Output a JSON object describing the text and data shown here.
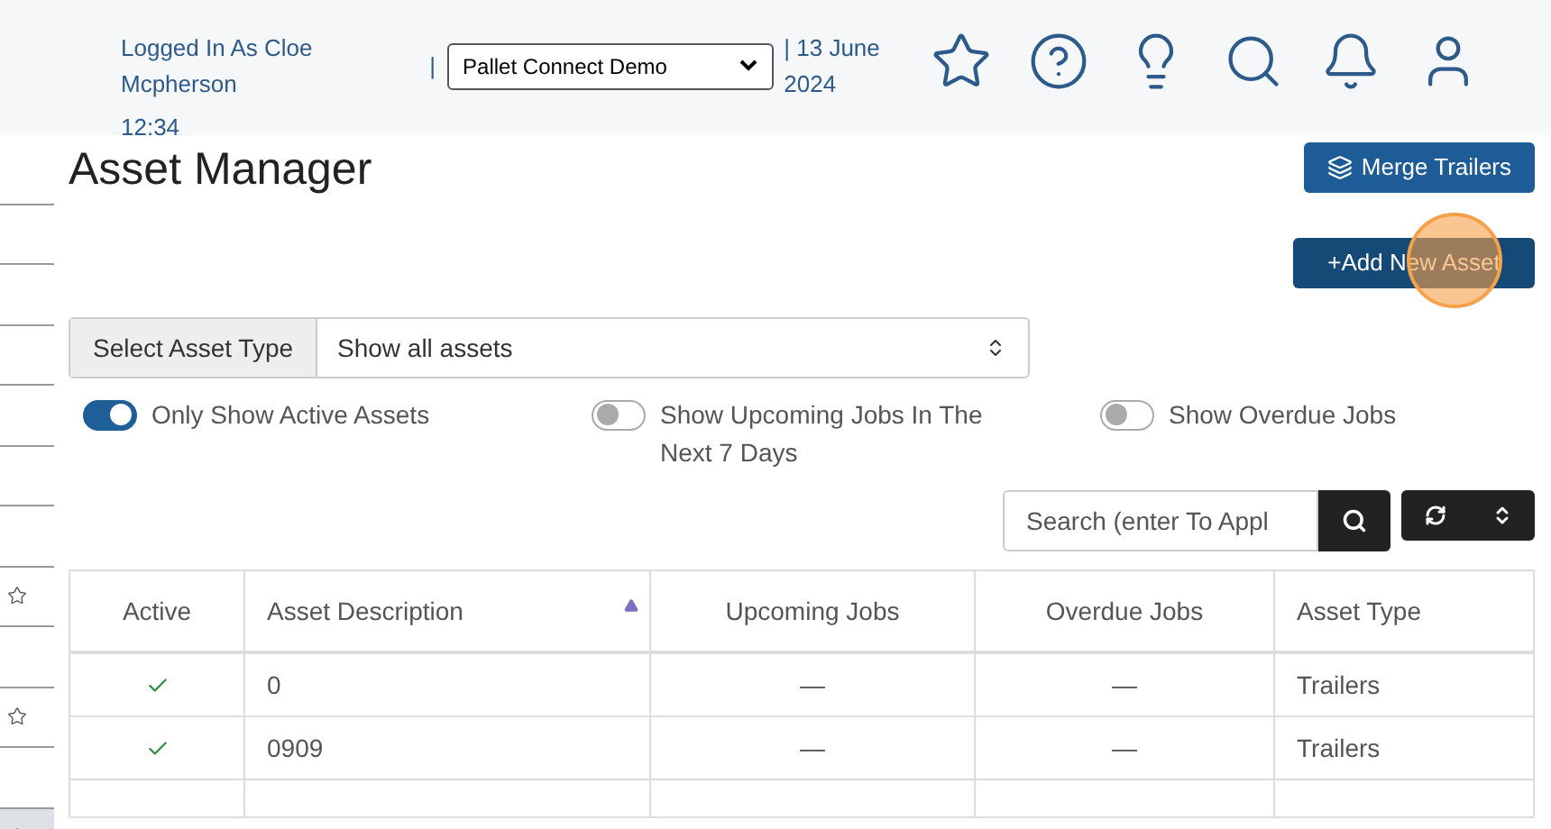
{
  "header": {
    "user_text": "Logged In As Cloe Mcpherson",
    "separator": "|",
    "company_select": "Pallet Connect Demo",
    "date_text": "| 13 June 2024",
    "time_text": "12:34"
  },
  "sidebar": {
    "rows": [
      {
        "starred": false,
        "selected": false
      },
      {
        "starred": false,
        "selected": false
      },
      {
        "starred": false,
        "selected": false
      },
      {
        "starred": false,
        "selected": false
      },
      {
        "starred": false,
        "selected": false
      },
      {
        "starred": false,
        "selected": false
      },
      {
        "starred": false,
        "selected": false
      },
      {
        "starred": true,
        "selected": false
      },
      {
        "starred": false,
        "selected": false
      },
      {
        "starred": true,
        "selected": false
      },
      {
        "starred": false,
        "selected": false
      },
      {
        "starred": true,
        "selected": true
      }
    ]
  },
  "page": {
    "title": "Asset Manager",
    "merge_button": "Merge Trailers",
    "add_button": "+Add New Asset"
  },
  "asset_type": {
    "label": "Select Asset Type",
    "value": "Show all assets"
  },
  "toggles": [
    {
      "label": "Only Show Active Assets",
      "on": true
    },
    {
      "label": "Show Upcoming Jobs In The Next 7 Days",
      "on": false
    },
    {
      "label": "Show Overdue Jobs",
      "on": false
    }
  ],
  "search": {
    "placeholder": "Search (enter To Appl"
  },
  "table": {
    "columns": [
      {
        "label": "Active",
        "sorted": false
      },
      {
        "label": "Asset Description",
        "sorted": true
      },
      {
        "label": "Upcoming Jobs",
        "sorted": false
      },
      {
        "label": "Overdue Jobs",
        "sorted": false
      },
      {
        "label": "Asset Type",
        "sorted": false
      }
    ],
    "rows": [
      {
        "active": true,
        "description": "0",
        "upcoming": "—",
        "overdue": "—",
        "type": "Trailers"
      },
      {
        "active": true,
        "description": "0909",
        "upcoming": "—",
        "overdue": "—",
        "type": "Trailers"
      }
    ]
  }
}
